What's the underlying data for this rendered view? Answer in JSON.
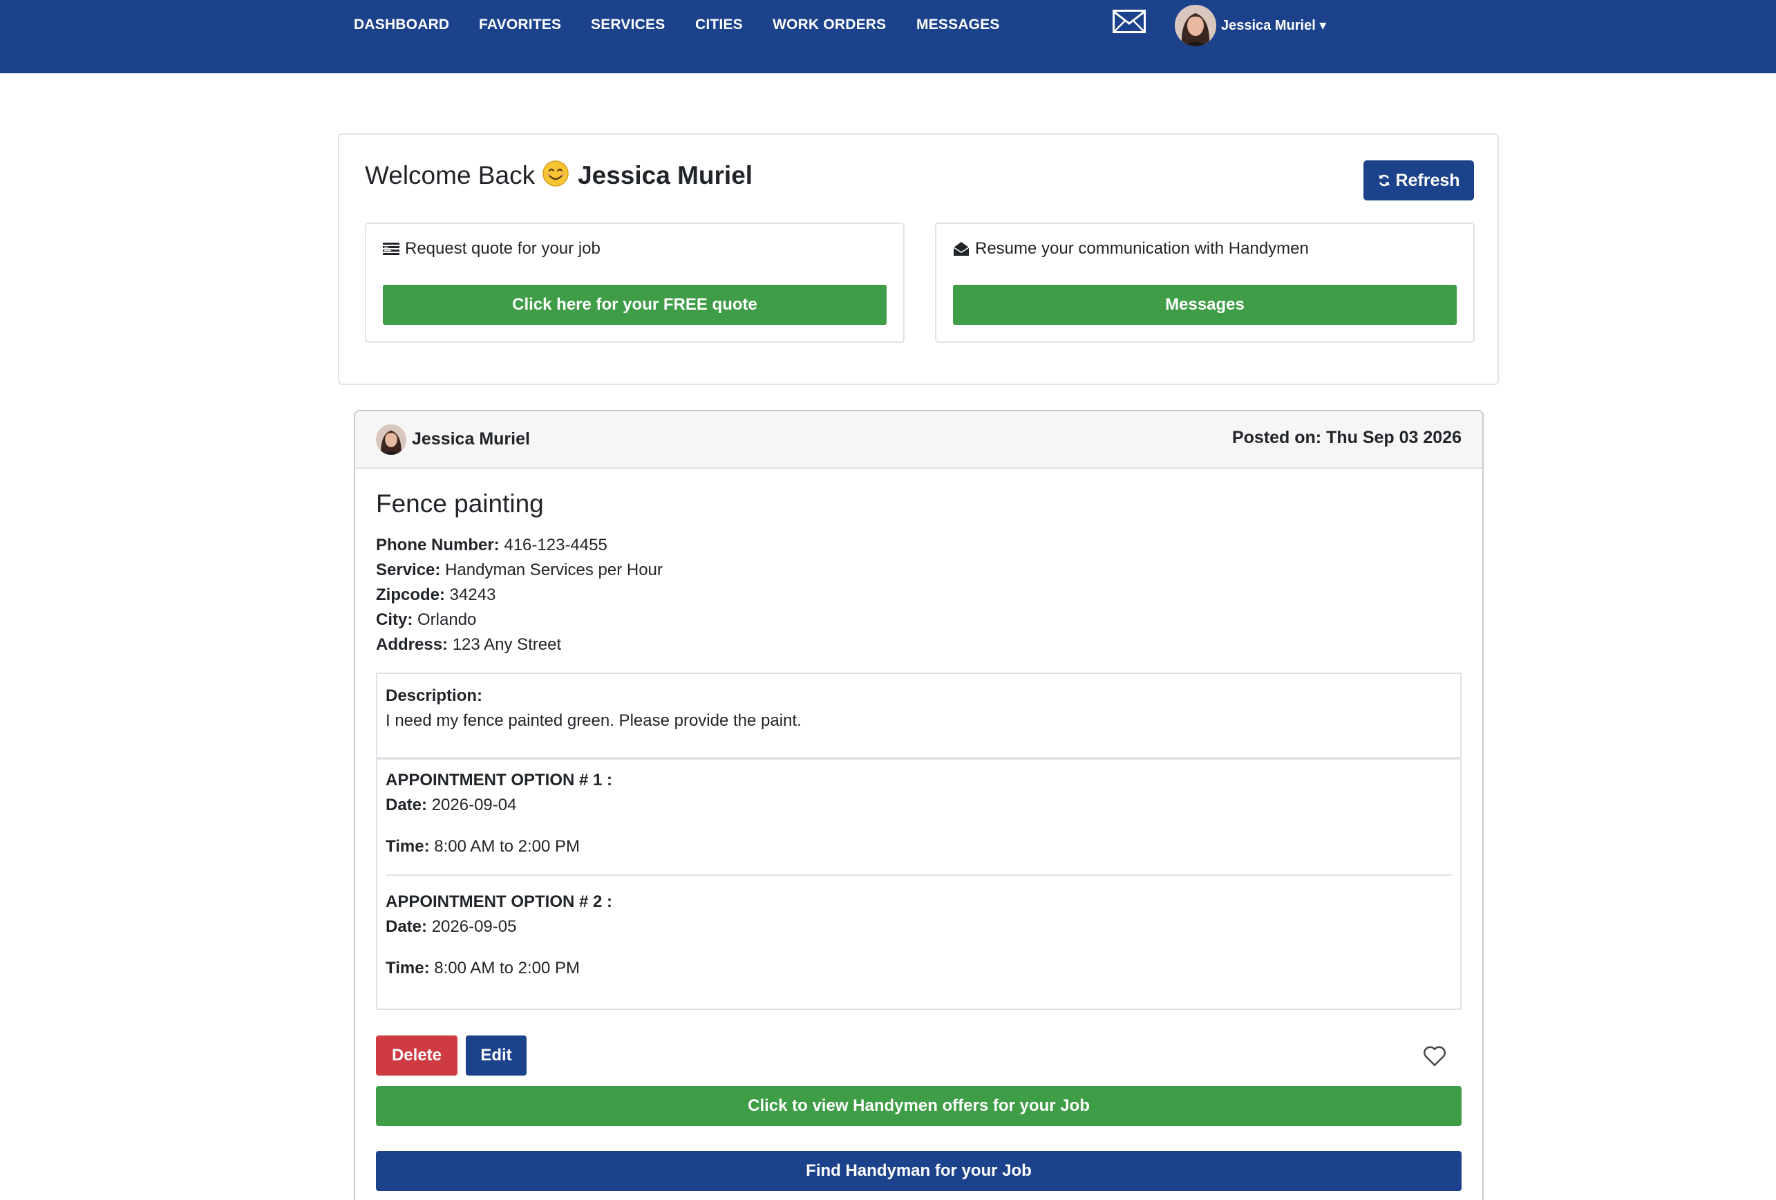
{
  "nav": {
    "items": [
      "DASHBOARD",
      "FAVORITES",
      "SERVICES",
      "CITIES",
      "WORK ORDERS",
      "MESSAGES"
    ],
    "user_menu": "Jessica Muriel ▾",
    "mail_icon": "envelope-icon"
  },
  "welcome": {
    "greeting": "Welcome Back",
    "emoji": "smiling-face-icon",
    "name": "Jessica Muriel",
    "refresh_label": "Refresh"
  },
  "quote_card": {
    "title": "Request quote for your job",
    "icon": "list-icon",
    "button_label": "Click here for your FREE quote"
  },
  "messages_card": {
    "title": "Resume your communication with Handymen",
    "icon": "open-envelope-icon",
    "button_label": "Messages"
  },
  "job": {
    "poster_name": "Jessica Muriel",
    "posted_on": "Posted on: Thu Sep 03 2026",
    "title": "Fence painting",
    "fields": [
      {
        "label": "Phone Number:",
        "value": "416-123-4455"
      },
      {
        "label": "Service:",
        "value": "Handyman Services per Hour"
      },
      {
        "label": "Zipcode:",
        "value": "34243"
      },
      {
        "label": "City:",
        "value": "Orlando"
      },
      {
        "label": "Address:",
        "value": "123 Any Street"
      }
    ],
    "description_label": "Description:",
    "description": "I need my fence painted green. Please provide the paint.",
    "appointments": [
      {
        "title": "APPOINTMENT OPTION # 1 :",
        "date_label": "Date:",
        "date": "2026-09-04",
        "time_label": "Time:",
        "time": "8:00 AM to 2:00 PM"
      },
      {
        "title": "APPOINTMENT OPTION # 2 :",
        "date_label": "Date:",
        "date": "2026-09-05",
        "time_label": "Time:",
        "time": "8:00 AM to 2:00 PM"
      }
    ],
    "delete_label": "Delete",
    "edit_label": "Edit",
    "offers_label": "Click to view Handymen offers for your Job",
    "find_label": "Find Handyman for your Job"
  },
  "colors": {
    "brand_blue": "#1b428a",
    "success_green": "#3e9d46",
    "danger_red": "#ce3b42"
  }
}
